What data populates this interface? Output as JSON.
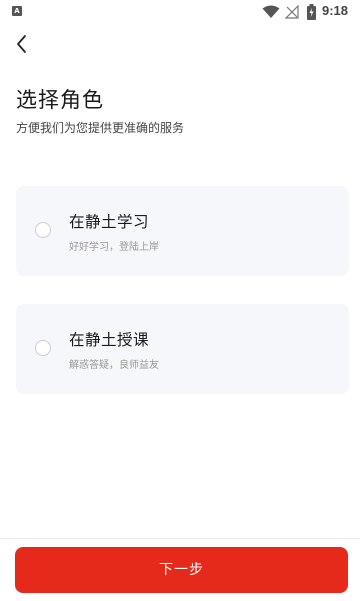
{
  "status_bar": {
    "notification_icon": "a-notification-icon",
    "time": "9:18",
    "icons": [
      "wifi-icon",
      "signal-off-icon",
      "battery-icon"
    ]
  },
  "header": {
    "back_icon": "chevron-left-icon"
  },
  "main": {
    "title": "选择角色",
    "subtitle": "方便我们为您提供更准确的服务",
    "roles": [
      {
        "title": "在静土学习",
        "description": "好好学习，登陆上岸",
        "selected": false
      },
      {
        "title": "在静土授课",
        "description": "解惑答疑，良师益友",
        "selected": false
      }
    ]
  },
  "footer": {
    "next_label": "下一步"
  },
  "colors": {
    "accent": "#e52a1c",
    "card_bg": "#f6f7fa"
  }
}
